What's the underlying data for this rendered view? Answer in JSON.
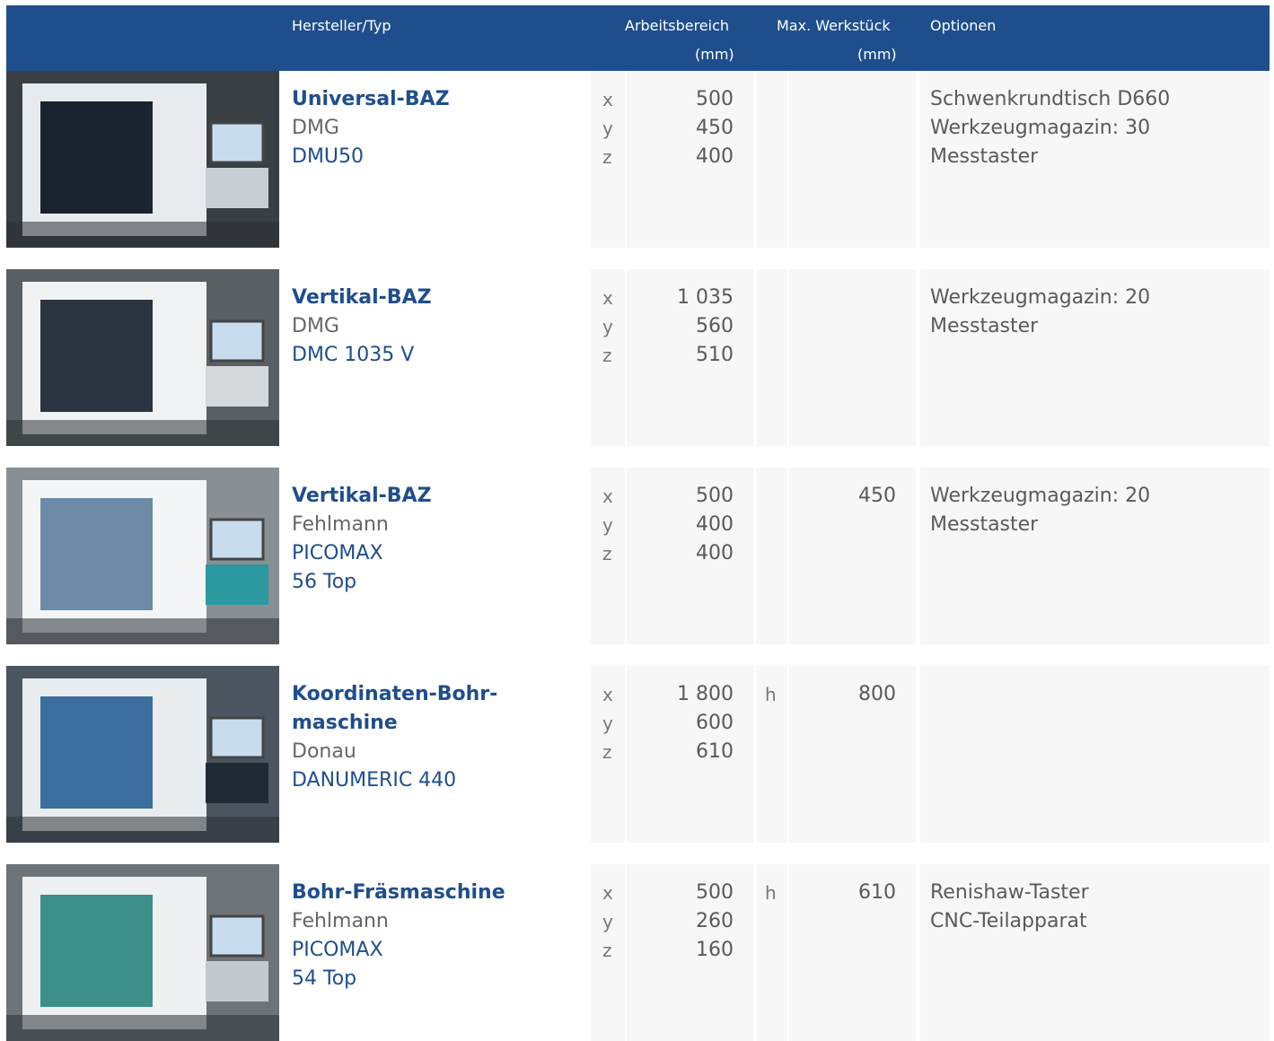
{
  "header": {
    "col_type": "Hersteller/Typ",
    "col_range_1": "Arbeitsbereich",
    "col_range_2": "(mm)",
    "col_piece_1": "Max. Werkstück",
    "col_piece_2": "(mm)",
    "col_options": "Optionen"
  },
  "rows": [
    {
      "type_lines": [
        "Universal-BAZ"
      ],
      "maker": "DMG",
      "model_lines": [
        "DMU50"
      ],
      "axes": [
        "x",
        "y",
        "z"
      ],
      "values": [
        "500",
        "450",
        "400"
      ],
      "piece_axis": "",
      "piece_value": "",
      "options": [
        "Schwenkrundtisch D660",
        "Werkzeugmagazin: 30",
        "Messtaster"
      ]
    },
    {
      "type_lines": [
        "Vertikal-BAZ"
      ],
      "maker": "DMG",
      "model_lines": [
        "DMC 1035 V"
      ],
      "axes": [
        "x",
        "y",
        "z"
      ],
      "values": [
        "1 035",
        "560",
        "510"
      ],
      "piece_axis": "",
      "piece_value": "",
      "options": [
        "Werkzeugmagazin: 20",
        "Messtaster"
      ]
    },
    {
      "type_lines": [
        "Vertikal-BAZ"
      ],
      "maker": "Fehlmann",
      "model_lines": [
        "PICOMAX",
        "56 Top"
      ],
      "axes": [
        "x",
        "y",
        "z"
      ],
      "values": [
        "500",
        "400",
        "400"
      ],
      "piece_axis": "",
      "piece_value": "450",
      "options": [
        "Werkzeugmagazin: 20",
        "Messtaster"
      ]
    },
    {
      "type_lines": [
        "Koordinaten-Bohr-",
        "maschine"
      ],
      "maker": "Donau",
      "model_lines": [
        "DANUMERIC 440"
      ],
      "axes": [
        "x",
        "y",
        "z"
      ],
      "values": [
        "1 800",
        "600",
        "610"
      ],
      "piece_axis": "h",
      "piece_value": "800",
      "options": []
    },
    {
      "type_lines": [
        "Bohr-Fräsmaschine"
      ],
      "maker": "Fehlmann",
      "model_lines": [
        "PICOMAX",
        "54 Top"
      ],
      "axes": [
        "x",
        "y",
        "z"
      ],
      "values": [
        "500",
        "260",
        "160"
      ],
      "piece_axis": "h",
      "piece_value": "610",
      "options": [
        "Renishaw-Taster",
        "CNC-Teilapparat"
      ]
    }
  ]
}
